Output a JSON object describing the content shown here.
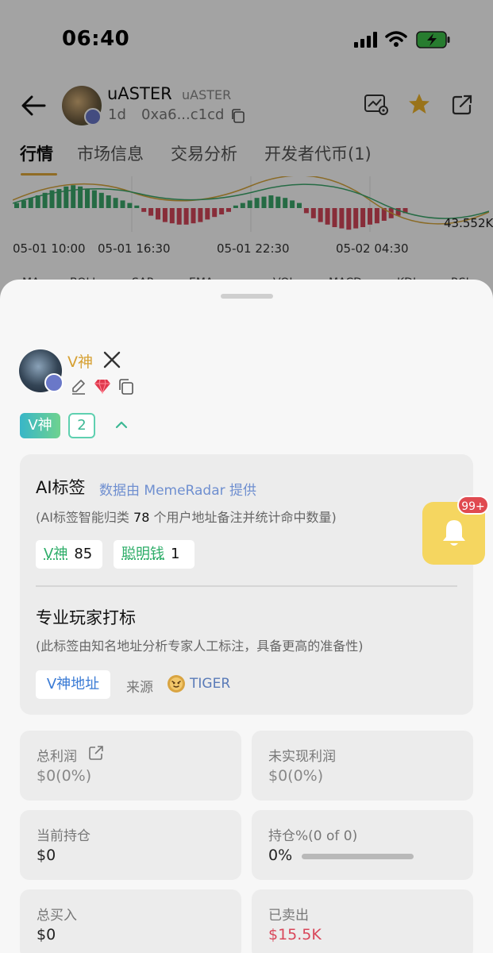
{
  "status_bar": {
    "time": "06:40"
  },
  "header": {
    "token_name": "uASTER",
    "token_symbol": "uASTER",
    "age": "1d",
    "address": "0xa6...c1cd"
  },
  "tabs": [
    "行情",
    "市场信息",
    "交易分析",
    "开发者代币(1)"
  ],
  "chart": {
    "value_label": "43.552K",
    "time_labels": [
      "05-01 10:00",
      "05-01 16:30",
      "05-01 22:30",
      "05-02 04:30"
    ],
    "indicators": [
      "MA",
      "BOLL",
      "SAR",
      "EMA",
      "VOL",
      "MACD",
      "KDJ",
      "RSI"
    ],
    "colors": {
      "up": "#3aa86b",
      "down": "#d5475a"
    }
  },
  "profile": {
    "name": "V神",
    "tag_main": "V神",
    "tag_count": "2"
  },
  "ai_card": {
    "title": "AI标签",
    "source": "数据由 MemeRadar 提供",
    "desc_prefix": "(AI标签智能归类",
    "desc_count": "78",
    "desc_suffix": "个用户地址备注并统计命中数量)",
    "chips": [
      {
        "label": "V神",
        "count": "85"
      },
      {
        "label": "聪明钱",
        "count": "1"
      }
    ],
    "pro_title": "专业玩家打标",
    "pro_desc": "(此标签由知名地址分析专家人工标注，具备更高的准备性)",
    "pro_chip": "V神地址",
    "source_label": "来源",
    "source_name": "TIGER"
  },
  "notification": {
    "badge": "99+"
  },
  "stats": {
    "total_profit": {
      "label": "总利润",
      "value": "$0(0%)"
    },
    "unrealized": {
      "label": "未实现利润",
      "value": "$0(0%)"
    },
    "holding": {
      "label": "当前持仓",
      "value": "$0"
    },
    "holding_pct": {
      "label": "持仓%(0 of 0)",
      "value": "0%",
      "fill": 0
    },
    "total_buy": {
      "label": "总买入",
      "value": "$0"
    },
    "sold": {
      "label": "已卖出",
      "value": "$15.5K"
    }
  }
}
